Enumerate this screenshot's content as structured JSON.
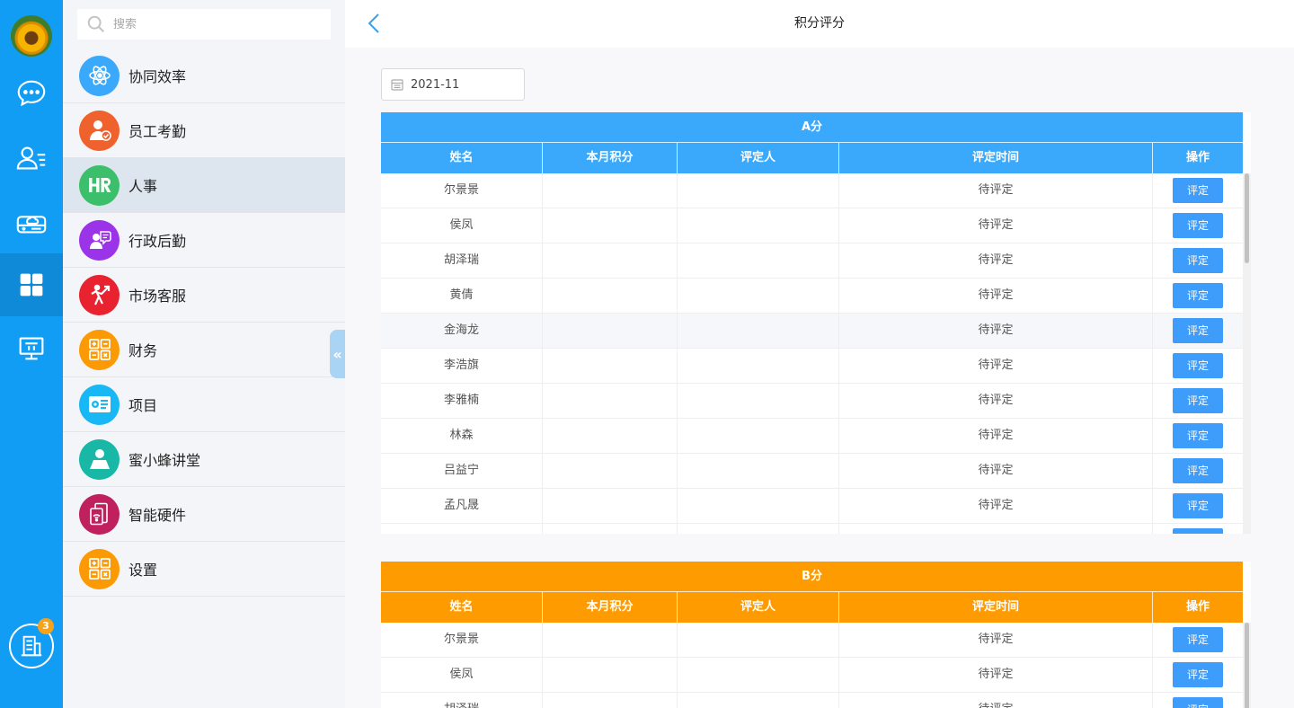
{
  "search": {
    "placeholder": "搜索"
  },
  "rail": {
    "badge_count": "3",
    "icons": [
      "chat-icon",
      "contacts-icon",
      "cloud-drive-icon",
      "apps-grid-icon",
      "desktop-icon",
      "organization-icon"
    ]
  },
  "menu": {
    "items": [
      {
        "label": "协同效率",
        "icon": "atom-icon",
        "color": "#3aa9fb"
      },
      {
        "label": "员工考勤",
        "icon": "employee-check-icon",
        "color": "#f0622d"
      },
      {
        "label": "人事",
        "icon": "hr-icon",
        "color": "#3cbf6a"
      },
      {
        "label": "行政后勤",
        "icon": "admin-icon",
        "color": "#9b34e8"
      },
      {
        "label": "市场客服",
        "icon": "market-icon",
        "color": "#e8232f"
      },
      {
        "label": "财务",
        "icon": "finance-icon",
        "color": "#fb9a04"
      },
      {
        "label": "项目",
        "icon": "project-icon",
        "color": "#18b8f4"
      },
      {
        "label": "蜜小蜂讲堂",
        "icon": "lecture-icon",
        "color": "#18b7a6"
      },
      {
        "label": "智能硬件",
        "icon": "hardware-icon",
        "color": "#c0205e"
      },
      {
        "label": "设置",
        "icon": "settings-icon",
        "color": "#fb9a04"
      }
    ],
    "active_index": 2
  },
  "header": {
    "title": "积分评分"
  },
  "filter": {
    "month": "2021-11"
  },
  "colors": {
    "table_a": "#3aa9fb",
    "table_b": "#fd9b00",
    "action_button": "#3e9cfb"
  },
  "columns": [
    "姓名",
    "本月积分",
    "评定人",
    "评定时间",
    "操作"
  ],
  "tables": [
    {
      "title": "A分",
      "rows": [
        {
          "name": "尔景景",
          "points": "",
          "rater": "",
          "time": "待评定",
          "action": "评定"
        },
        {
          "name": "侯凤",
          "points": "",
          "rater": "",
          "time": "待评定",
          "action": "评定"
        },
        {
          "name": "胡泽瑞",
          "points": "",
          "rater": "",
          "time": "待评定",
          "action": "评定"
        },
        {
          "name": "黄倩",
          "points": "",
          "rater": "",
          "time": "待评定",
          "action": "评定"
        },
        {
          "name": "金海龙",
          "points": "",
          "rater": "",
          "time": "待评定",
          "action": "评定"
        },
        {
          "name": "李浩旗",
          "points": "",
          "rater": "",
          "time": "待评定",
          "action": "评定"
        },
        {
          "name": "李雅楠",
          "points": "",
          "rater": "",
          "time": "待评定",
          "action": "评定"
        },
        {
          "name": "林森",
          "points": "",
          "rater": "",
          "time": "待评定",
          "action": "评定"
        },
        {
          "name": "吕益宁",
          "points": "",
          "rater": "",
          "time": "待评定",
          "action": "评定"
        },
        {
          "name": "孟凡晟",
          "points": "",
          "rater": "",
          "time": "待评定",
          "action": "评定"
        },
        {
          "name": "",
          "points": "",
          "rater": "",
          "time": "",
          "action": "评定"
        }
      ]
    },
    {
      "title": "B分",
      "rows": [
        {
          "name": "尔景景",
          "points": "",
          "rater": "",
          "time": "待评定",
          "action": "评定"
        },
        {
          "name": "侯凤",
          "points": "",
          "rater": "",
          "time": "待评定",
          "action": "评定"
        },
        {
          "name": "胡泽瑞",
          "points": "",
          "rater": "",
          "time": "待评定",
          "action": "评定"
        }
      ]
    }
  ]
}
